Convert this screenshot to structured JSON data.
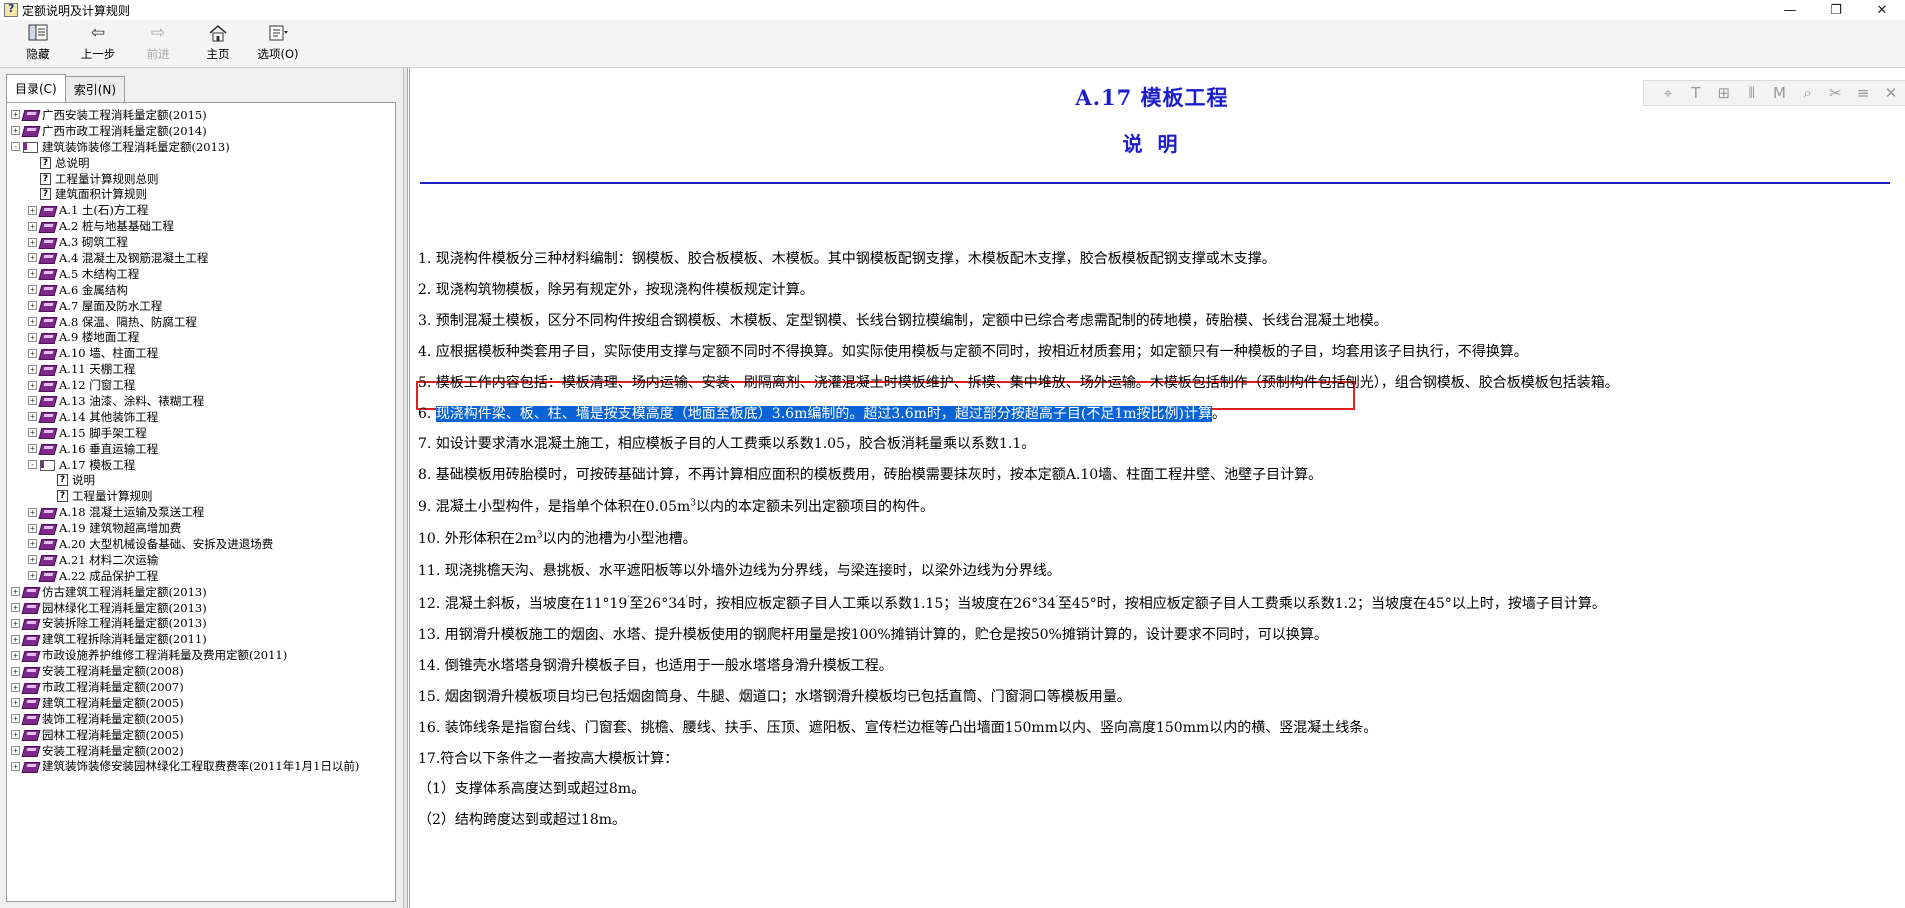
{
  "window": {
    "title": "定额说明及计算规则",
    "controls": {
      "minimize": "—",
      "restore": "❐",
      "close": "✕"
    }
  },
  "toolbar": [
    {
      "label": "隐藏",
      "icon": "hide-icon"
    },
    {
      "label": "上一步",
      "icon": "back-arrow-icon"
    },
    {
      "label": "前进",
      "icon": "forward-arrow-icon",
      "disabled": true
    },
    {
      "label": "主页",
      "icon": "home-icon"
    },
    {
      "label": "选项(O)",
      "icon": "options-icon"
    }
  ],
  "tabs": [
    {
      "label": "目录(C)",
      "active": true
    },
    {
      "label": "索引(N)",
      "active": false
    }
  ],
  "tree": [
    {
      "level": 0,
      "type": "book",
      "exp": "+",
      "label": "广西安装工程消耗量定额(2015)"
    },
    {
      "level": 0,
      "type": "book",
      "exp": "+",
      "label": "广西市政工程消耗量定额(2014)"
    },
    {
      "level": 0,
      "type": "book-open",
      "exp": "-",
      "label": "建筑装饰装修工程消耗量定额(2013)"
    },
    {
      "level": 1,
      "type": "page",
      "exp": "",
      "label": "总说明"
    },
    {
      "level": 1,
      "type": "page",
      "exp": "",
      "label": "工程量计算规则总则"
    },
    {
      "level": 1,
      "type": "page",
      "exp": "",
      "label": "建筑面积计算规则"
    },
    {
      "level": 1,
      "type": "book",
      "exp": "+",
      "label": "A.1 土(石)方工程"
    },
    {
      "level": 1,
      "type": "book",
      "exp": "+",
      "label": "A.2 桩与地基基础工程"
    },
    {
      "level": 1,
      "type": "book",
      "exp": "+",
      "label": "A.3 砌筑工程"
    },
    {
      "level": 1,
      "type": "book",
      "exp": "+",
      "label": "A.4 混凝土及钢筋混凝土工程"
    },
    {
      "level": 1,
      "type": "book",
      "exp": "+",
      "label": "A.5 木结构工程"
    },
    {
      "level": 1,
      "type": "book",
      "exp": "+",
      "label": "A.6 金属结构"
    },
    {
      "level": 1,
      "type": "book",
      "exp": "+",
      "label": "A.7 屋面及防水工程"
    },
    {
      "level": 1,
      "type": "book",
      "exp": "+",
      "label": "A.8 保温、隔热、防腐工程"
    },
    {
      "level": 1,
      "type": "book",
      "exp": "+",
      "label": "A.9 楼地面工程"
    },
    {
      "level": 1,
      "type": "book",
      "exp": "+",
      "label": "A.10 墙、柱面工程"
    },
    {
      "level": 1,
      "type": "book",
      "exp": "+",
      "label": "A.11 天棚工程"
    },
    {
      "level": 1,
      "type": "book",
      "exp": "+",
      "label": "A.12 门窗工程"
    },
    {
      "level": 1,
      "type": "book",
      "exp": "+",
      "label": "A.13 油漆、涂料、裱糊工程"
    },
    {
      "level": 1,
      "type": "book",
      "exp": "+",
      "label": "A.14 其他装饰工程"
    },
    {
      "level": 1,
      "type": "book",
      "exp": "+",
      "label": "A.15 脚手架工程"
    },
    {
      "level": 1,
      "type": "book",
      "exp": "+",
      "label": "A.16 垂直运输工程"
    },
    {
      "level": 1,
      "type": "book-open",
      "exp": "-",
      "label": "A.17 模板工程"
    },
    {
      "level": 2,
      "type": "page",
      "exp": "",
      "label": "说明"
    },
    {
      "level": 2,
      "type": "page",
      "exp": "",
      "label": "工程量计算规则"
    },
    {
      "level": 1,
      "type": "book",
      "exp": "+",
      "label": "A.18 混凝土运输及泵送工程"
    },
    {
      "level": 1,
      "type": "book",
      "exp": "+",
      "label": "A.19 建筑物超高增加费"
    },
    {
      "level": 1,
      "type": "book",
      "exp": "+",
      "label": "A.20 大型机械设备基础、安拆及进退场费"
    },
    {
      "level": 1,
      "type": "book",
      "exp": "+",
      "label": "A.21 材料二次运输"
    },
    {
      "level": 1,
      "type": "book",
      "exp": "+",
      "label": "A.22 成品保护工程"
    },
    {
      "level": 0,
      "type": "book",
      "exp": "+",
      "label": "仿古建筑工程消耗量定额(2013)"
    },
    {
      "level": 0,
      "type": "book",
      "exp": "+",
      "label": "园林绿化工程消耗量定额(2013)"
    },
    {
      "level": 0,
      "type": "book",
      "exp": "+",
      "label": "安装拆除工程消耗量定额(2013)"
    },
    {
      "level": 0,
      "type": "book",
      "exp": "+",
      "label": "建筑工程拆除消耗量定额(2011)"
    },
    {
      "level": 0,
      "type": "book",
      "exp": "+",
      "label": "市政设施养护维修工程消耗量及费用定额(2011)"
    },
    {
      "level": 0,
      "type": "book",
      "exp": "+",
      "label": "安装工程消耗量定额(2008)"
    },
    {
      "level": 0,
      "type": "book",
      "exp": "+",
      "label": "市政工程消耗量定额(2007)"
    },
    {
      "level": 0,
      "type": "book",
      "exp": "+",
      "label": "建筑工程消耗量定额(2005)"
    },
    {
      "level": 0,
      "type": "book",
      "exp": "+",
      "label": "装饰工程消耗量定额(2005)"
    },
    {
      "level": 0,
      "type": "book",
      "exp": "+",
      "label": "园林工程消耗量定额(2005)"
    },
    {
      "level": 0,
      "type": "book",
      "exp": "+",
      "label": "安装工程消耗量定额(2002)"
    },
    {
      "level": 0,
      "type": "book",
      "exp": "+",
      "label": "建筑装饰装修安装园林绿化工程取费费率(2011年1月1日以前)"
    }
  ],
  "doc": {
    "title": "A.17 模板工程",
    "subtitle": "说 明",
    "tools": [
      "⌖",
      "T",
      "⊞",
      "⦀",
      "M",
      "⌕",
      "✂",
      "≡",
      "✕"
    ],
    "paragraphs": [
      {
        "segments": [
          {
            "text": "1. 现浇构件模板分三种材料编制：钢模板、胶合板模板、木模板。其中钢模板配钢支撑，木模板配木支撑，胶合板模板配钢支撑或木支撑。"
          }
        ]
      },
      {
        "segments": [
          {
            "text": "2. 现浇构筑物模板，除另有规定外，按现浇构件模板规定计算。"
          }
        ]
      },
      {
        "segments": [
          {
            "text": "3. 预制混凝土模板，区分不同构件按组合钢模板、木模板、定型钢模、长线台钢拉模编制，定额中已综合考虑需配制的砖地模，砖胎模、长线台混凝土地模。"
          }
        ]
      },
      {
        "segments": [
          {
            "text": "4. 应根据模板种类套用子目，实际使用支撑与定额不同时不得换算。如实际使用模板与定额不同时，按相近材质套用；如定额只有一种模板的子目，均套用该子目执行，不得换算。"
          }
        ]
      },
      {
        "segments": [
          {
            "text": "5. 模板工作内容包括：模板清理、场内运输、安装、刷隔离剂、浇灌混凝土时模板维护、拆模、集中堆放、场外运输。木模板包括制作（预制构件包括刨光），组合钢模板、胶合板模板包括装箱。"
          }
        ]
      },
      {
        "segments": [
          {
            "text": "6. "
          },
          {
            "text": "现浇构件梁、板、柱、墙是按支模高度（地面至板底）3.6m编制的。超过3.6m时，超过部分按超高子目(不足1m按比例)计算",
            "hl": true
          },
          {
            "text": "。"
          }
        ]
      },
      {
        "segments": [
          {
            "text": "7. 如设计要求清水混凝土施工，相应模板子目的人工费乘以系数1.05，胶合板消耗量乘以系数1.1。"
          }
        ]
      },
      {
        "segments": [
          {
            "text": "8. 基础模板用砖胎模时，可按砖基础计算，不再计算相应面积的模板费用，砖胎模需要抹灰时，按本定额A.10墙、柱面工程井壁、池壁子目计算。"
          }
        ]
      },
      {
        "segments": [
          {
            "text": "9. 混凝土小型构件，是指单个体积在0.05m"
          },
          {
            "text": "3",
            "sup": true
          },
          {
            "text": "以内的本定额未列出定额项目的构件。"
          }
        ]
      },
      {
        "segments": [
          {
            "text": "10. 外形体积在2m"
          },
          {
            "text": "3",
            "sup": true
          },
          {
            "text": "以内的池槽为小型池槽。"
          }
        ]
      },
      {
        "segments": [
          {
            "text": "11. 现浇挑檐天沟、悬挑板、水平遮阳板等以外墙外边线为分界线，与梁连接时，以梁外边线为分界线。"
          }
        ]
      },
      {
        "segments": [
          {
            "text": "12. 混凝土斜板，当坡度在11°19"
          },
          {
            "text": "′",
            "sup": true
          },
          {
            "text": "至26°34"
          },
          {
            "text": "′",
            "sup": true
          },
          {
            "text": "时，按相应板定额子目人工乘以系数1.15；当坡度在26°34"
          },
          {
            "text": "′",
            "sup": true
          },
          {
            "text": "至45°时，按相应板定额子目人工费乘以系数1.2；当坡度在45°以上时，按墙子目计算。"
          }
        ]
      },
      {
        "segments": [
          {
            "text": "13. 用钢滑升模板施工的烟囱、水塔、提升模板使用的钢爬杆用量是按100%摊销计算的，贮仓是按50%摊销计算的，设计要求不同时，可以换算。"
          }
        ]
      },
      {
        "segments": [
          {
            "text": "14. 倒锥壳水塔塔身钢滑升模板子目，也适用于一般水塔塔身滑升模板工程。"
          }
        ]
      },
      {
        "segments": [
          {
            "text": "15. 烟囱钢滑升模板项目均已包括烟囱筒身、牛腿、烟道口；水塔钢滑升模板均已包括直筒、门窗洞口等模板用量。"
          }
        ]
      },
      {
        "segments": [
          {
            "text": "16. 装饰线条是指窗台线、门窗套、挑檐、腰线、扶手、压顶、遮阳板、宣传栏边框等凸出墙面150mm以内、竖向高度150mm以内的横、竖混凝土线条。"
          }
        ]
      },
      {
        "segments": [
          {
            "text": "17.符合以下条件之一者按高大模板计算："
          }
        ]
      },
      {
        "segments": [
          {
            "text": "（1）支撑体系高度达到或超过8m。"
          }
        ]
      },
      {
        "segments": [
          {
            "text": "（2）结构跨度达到或超过18m。"
          }
        ]
      }
    ]
  }
}
